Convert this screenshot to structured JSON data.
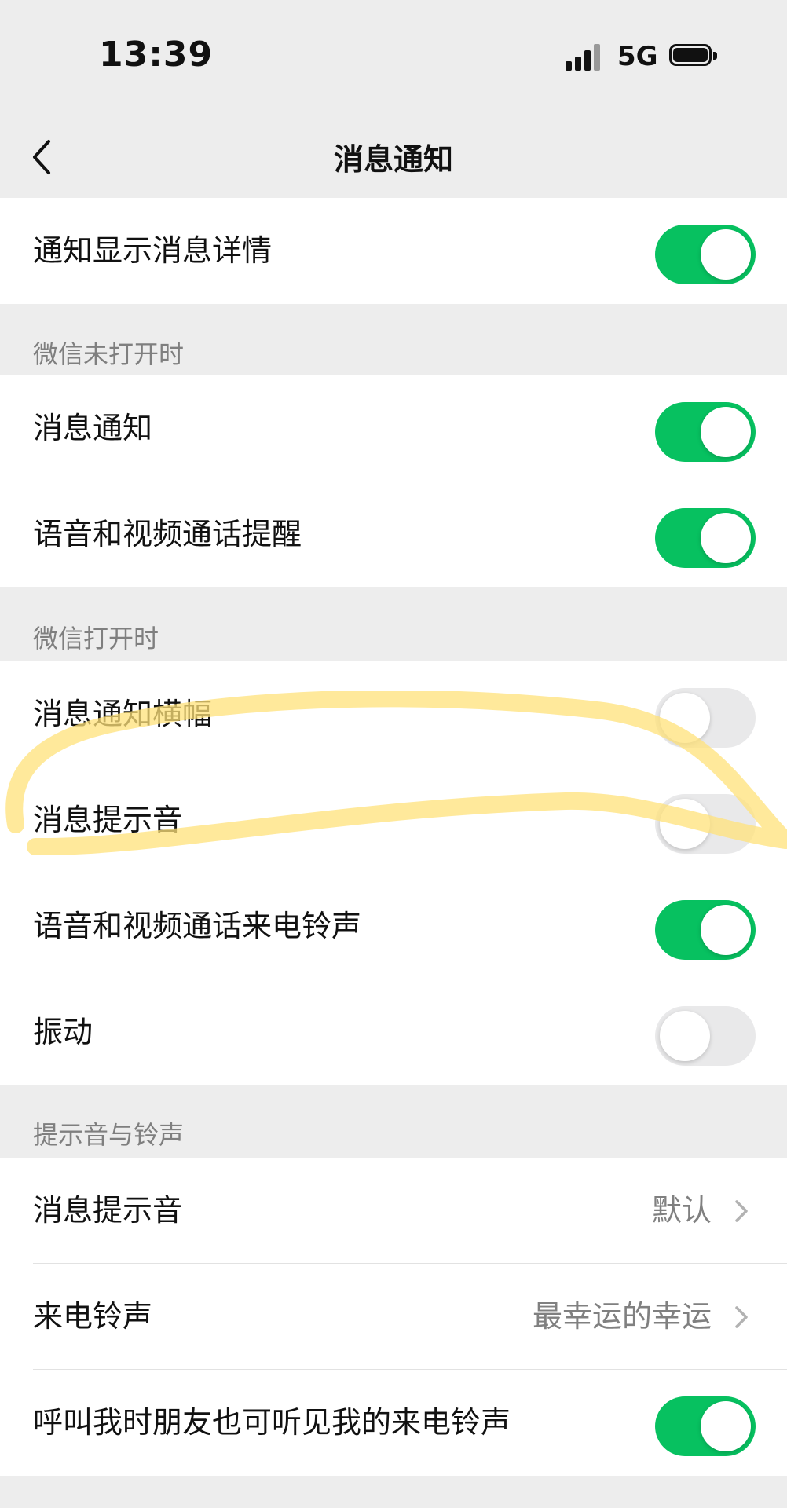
{
  "status_bar": {
    "time": "13:39",
    "network": "5G"
  },
  "nav": {
    "title": "消息通知"
  },
  "top_group": {
    "items": [
      {
        "label": "通知显示消息详情",
        "on": true
      }
    ]
  },
  "wechat_closed": {
    "header": "微信未打开时",
    "items": [
      {
        "label": "消息通知",
        "on": true
      },
      {
        "label": "语音和视频通话提醒",
        "on": true
      }
    ]
  },
  "wechat_open": {
    "header": "微信打开时",
    "items": [
      {
        "label": "消息通知横幅",
        "on": false
      },
      {
        "label": "消息提示音",
        "on": false
      },
      {
        "label": "语音和视频通话来电铃声",
        "on": true
      },
      {
        "label": "振动",
        "on": false
      }
    ]
  },
  "sounds": {
    "header": "提示音与铃声",
    "items": [
      {
        "label": "消息提示音",
        "value": "默认"
      },
      {
        "label": "来电铃声",
        "value": "最幸运的幸运"
      },
      {
        "label": "呼叫我时朋友也可听见我的来电铃声",
        "on": true
      }
    ]
  },
  "colors": {
    "toggle_on": "#07c160",
    "toggle_off": "#e9e9ea",
    "highlight": "#ffe27a"
  }
}
